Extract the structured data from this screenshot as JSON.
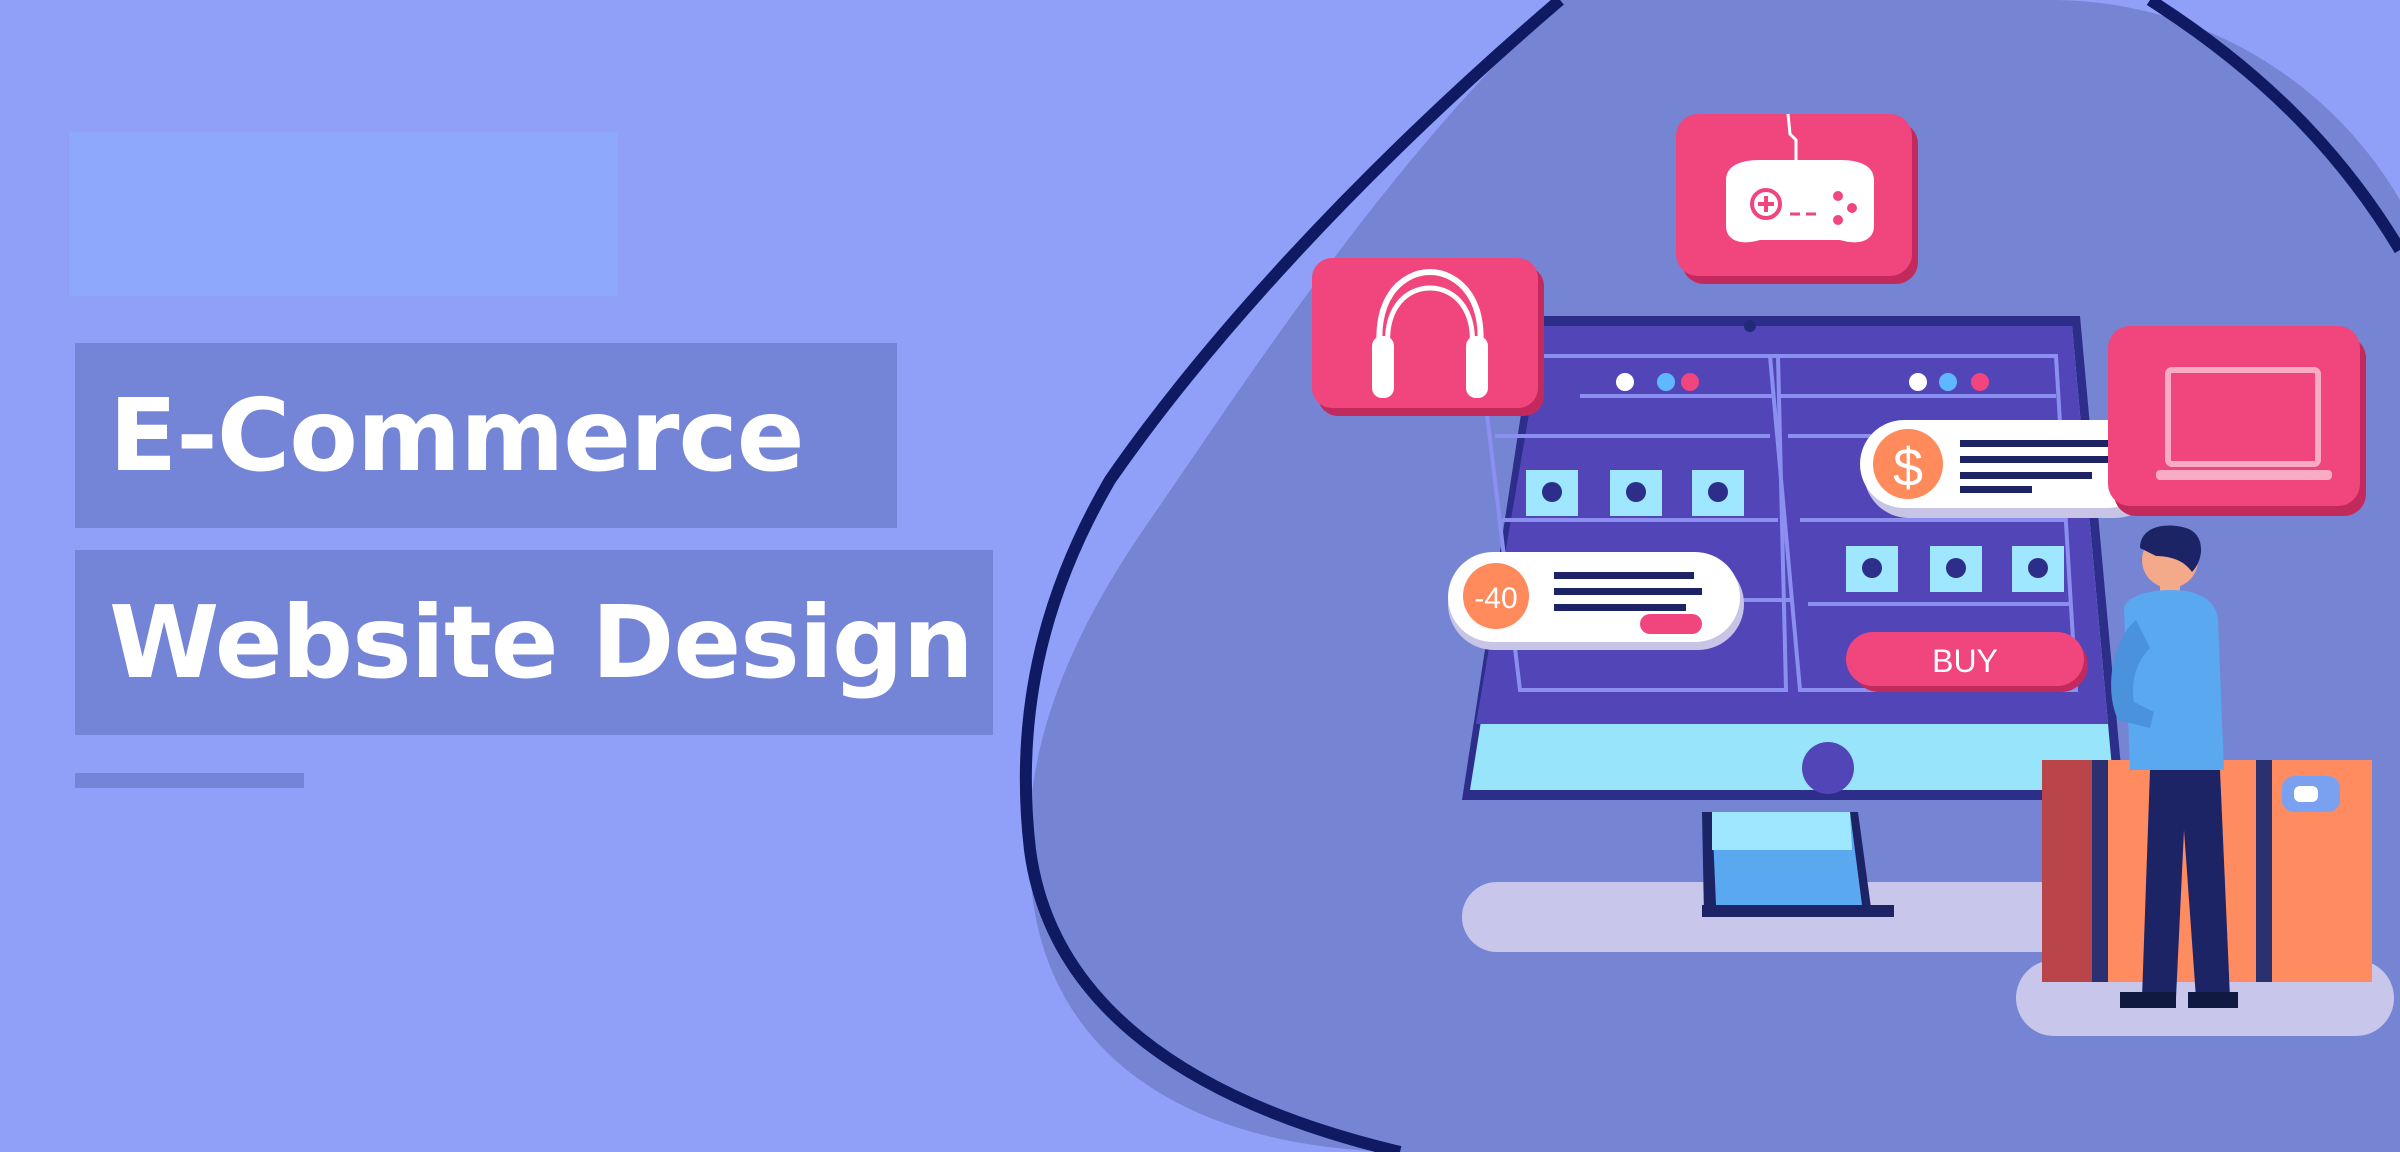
{
  "hero": {
    "title_line_1": "E-Commerce",
    "title_line_2": "Website Design"
  },
  "illustration": {
    "discount_tag": "-40",
    "price_icon": "$",
    "buy_button": "BUY",
    "icons": [
      "gamepad-icon",
      "headphones-icon",
      "laptop-icon",
      "monitor-icon",
      "person-figure",
      "shopping-box"
    ]
  },
  "colors": {
    "background": "#90a0f8",
    "blob": "#7585d3",
    "outline": "#101a63",
    "title_bg": "#7484d6",
    "accent_pink": "#f0457d",
    "screen": "#5348c0"
  }
}
